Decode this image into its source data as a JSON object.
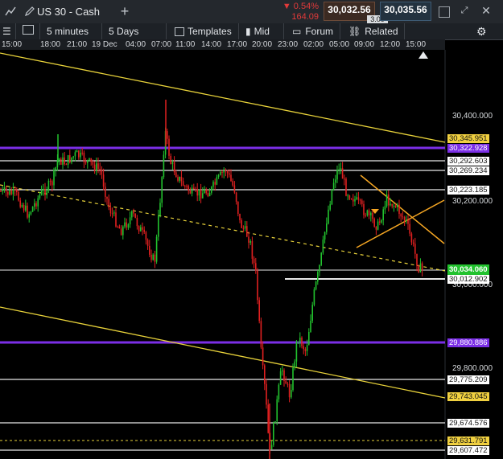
{
  "header": {
    "instrument": "US 30 - Cash",
    "change_pct": "▼ 0.54%",
    "change_abs": "164.09",
    "sell_price": "30,032.56",
    "buy_price": "30,035.56",
    "spread": "3.00"
  },
  "toolbar": {
    "interval": "5 minutes",
    "range": "5 Days",
    "templates": "Templates",
    "price_type": "Mid",
    "forum": "Forum",
    "related": "Related"
  },
  "time_axis": [
    "15:00",
    "18:00",
    "21:00",
    "19 Dec",
    "04:00",
    "07:00",
    "11:00",
    "14:00",
    "17:00",
    "20:00",
    "23:00",
    "02:00",
    "05:00",
    "09:00",
    "12:00",
    "15:00"
  ],
  "price_axis": [
    "30,400.000",
    "30,200.000",
    "30,000.000",
    "29,800.000"
  ],
  "levels": [
    {
      "label": "30,345.951",
      "style": "yellow"
    },
    {
      "label": "30,322.928",
      "style": "purple"
    },
    {
      "label": "30,292.603",
      "style": "white"
    },
    {
      "label": "30,269.234",
      "style": "white"
    },
    {
      "label": "30,223.185",
      "style": "white"
    },
    {
      "label": "30,034.060",
      "style": "green"
    },
    {
      "label": "30,012.902",
      "style": "white"
    },
    {
      "label": "29,880.886",
      "style": "purple"
    },
    {
      "label": "29,775.209",
      "style": "white"
    },
    {
      "label": "29,743.045",
      "style": "yellow"
    },
    {
      "label": "29,674.576",
      "style": "white"
    },
    {
      "label": "29,631.791",
      "style": "yellow"
    },
    {
      "label": "29,607.472",
      "style": "white"
    }
  ],
  "colors": {
    "up": "#22c22e",
    "down": "#e02020",
    "trend": "#e8d23a",
    "purple": "#7b2ee6",
    "orange": "#f5a623",
    "green_label": "#22c22e"
  },
  "icons": [
    "chart-icon",
    "pencil-icon",
    "plus-icon",
    "menu-icon",
    "layout-icon",
    "compare-icon",
    "indicator-icon",
    "comment-icon",
    "link-icon",
    "settings-icon",
    "window-icon",
    "resize-icon",
    "close-icon"
  ]
}
